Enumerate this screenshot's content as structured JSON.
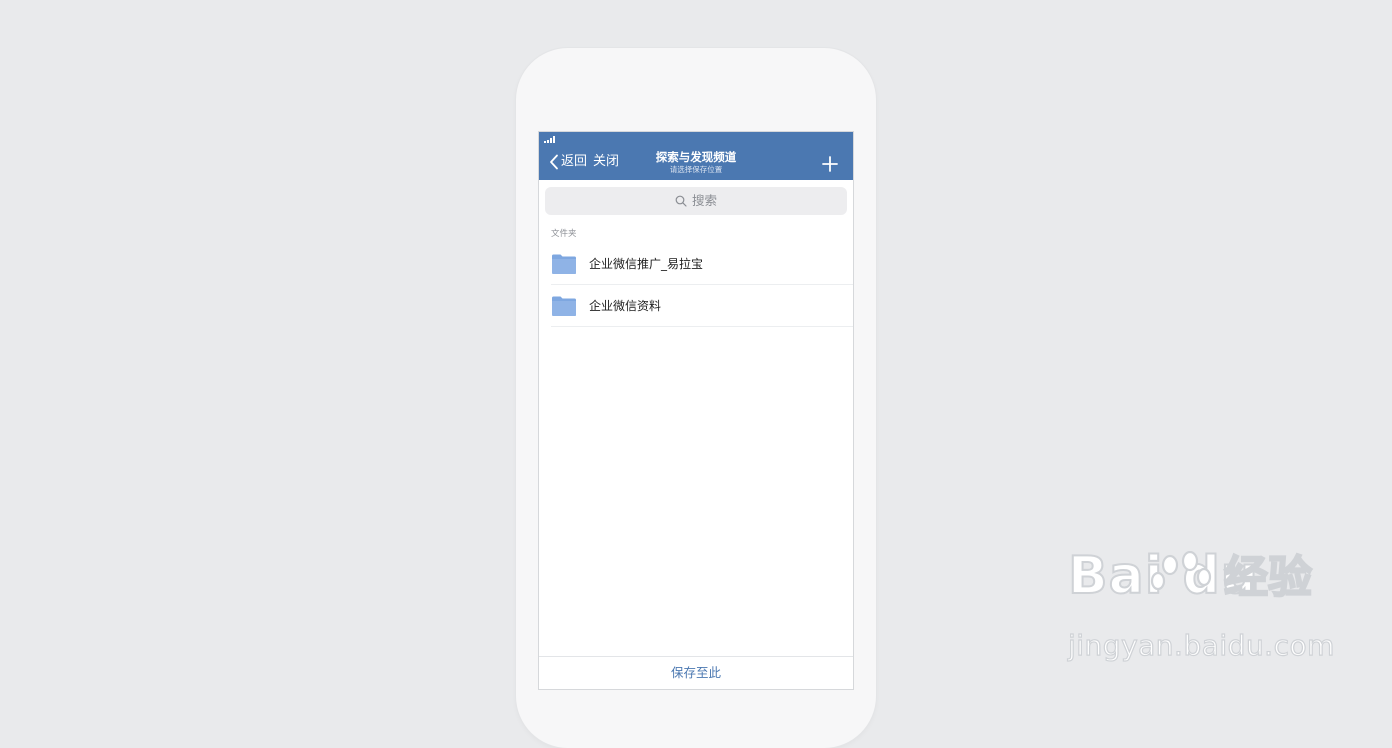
{
  "navbar": {
    "back_label": "返回",
    "close_label": "关闭",
    "title": "探索与发现频道",
    "subtitle": "请选择保存位置",
    "background_color": "#4b78b1"
  },
  "search": {
    "placeholder": "搜索"
  },
  "folders": {
    "section_label": "文件夹",
    "items": [
      {
        "name": "企业微信推广_易拉宝",
        "icon": "folder-icon"
      },
      {
        "name": "企业微信资料",
        "icon": "folder-icon"
      }
    ],
    "folder_color": "#8fb3e6"
  },
  "bottom_bar": {
    "save_label": "保存至此"
  },
  "watermark": {
    "logo_text": "Bai du",
    "product_text": "经验",
    "url": "jingyan.baidu.com"
  },
  "icons": {
    "back": "chevron-left-icon",
    "add": "plus-icon",
    "search": "search-icon",
    "signal": "signal-icon"
  }
}
